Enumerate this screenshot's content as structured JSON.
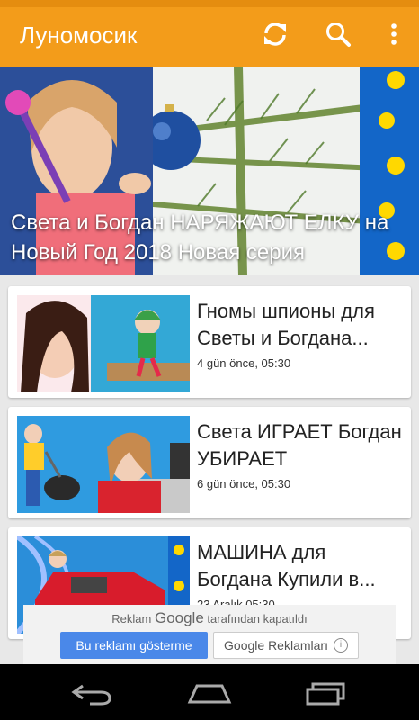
{
  "app": {
    "title": "Лунoмосик"
  },
  "toolbar": {
    "icons": [
      "refresh-icon",
      "search-icon",
      "more-vert-icon"
    ]
  },
  "featured": {
    "title": "Света и Богдан НАРЯЖАЮТ ЕЛКУ на Новый Год 2018 Новая серия"
  },
  "videos": [
    {
      "title": "Гномы шпионы для Светы и Богдана...",
      "meta": "4 gün önce, 05:30"
    },
    {
      "title": "Света ИГРАЕТ Богдан УБИРАЕТ",
      "meta": "6 gün önce, 05:30"
    },
    {
      "title": "МАШИНА для Богдана Купили в...",
      "meta": "23 Aralık 05:30"
    }
  ],
  "ad": {
    "prefix": "Reklam",
    "google": "Google",
    "suffix": "tarafından kapatıldı",
    "show_button": "Bu reklamı gösterme",
    "ads_button": "Google Reklamları",
    "info_glyph": "i"
  },
  "colors": {
    "appbar": "#f39c1a",
    "ad_button": "#4a88e9"
  },
  "navbar": {
    "icons": [
      "back-icon",
      "home-icon",
      "recents-icon"
    ]
  }
}
